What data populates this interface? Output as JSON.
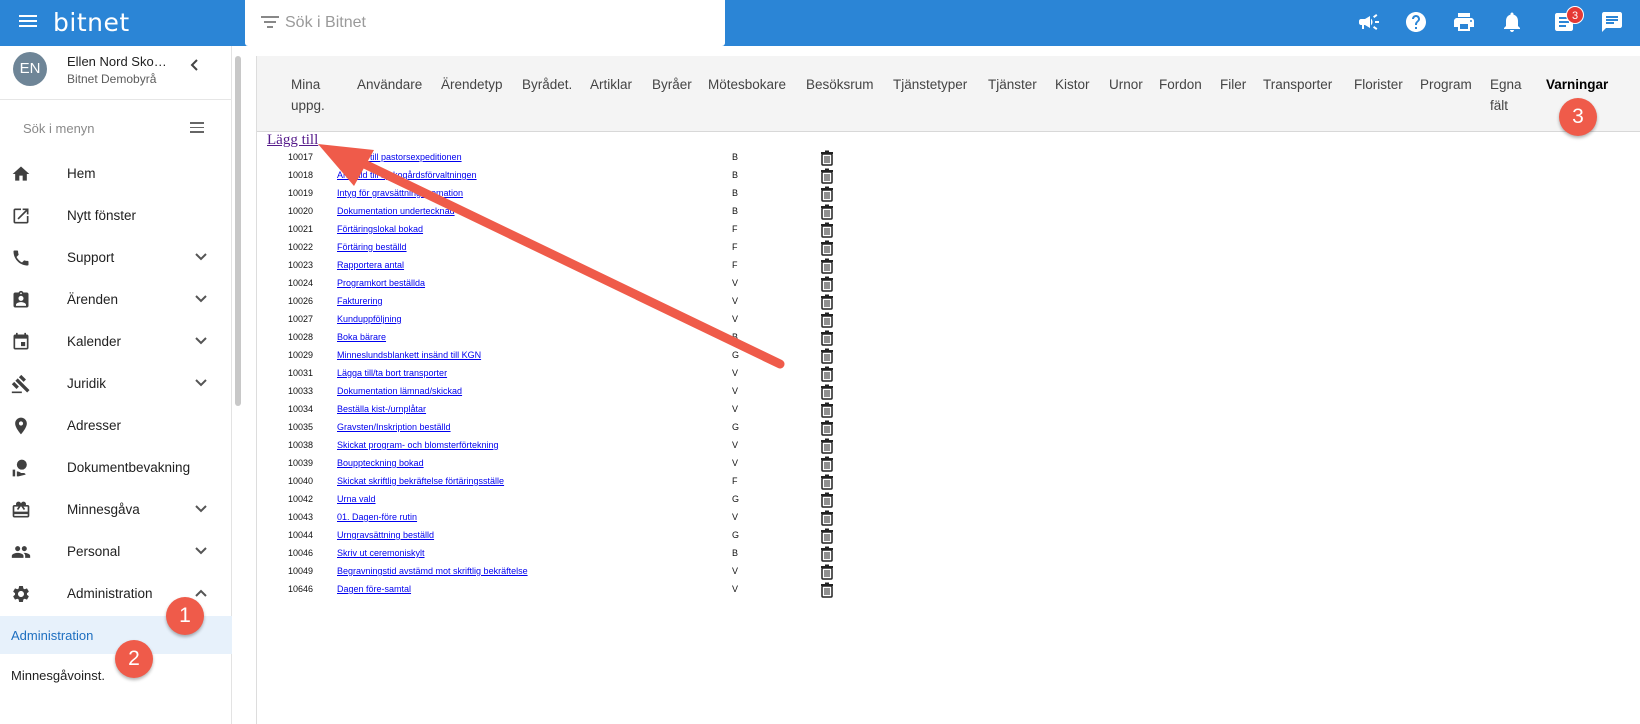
{
  "app": {
    "logo": "bitnet",
    "search_placeholder": "Sök i Bitnet",
    "notification_count": "3"
  },
  "user": {
    "initials": "EN",
    "name": "Ellen Nord Sko…",
    "org": "Bitnet Demobyrå"
  },
  "sidebar": {
    "search_placeholder": "Sök i menyn",
    "items": [
      {
        "label": "Hem",
        "icon": "home-icon"
      },
      {
        "label": "Nytt fönster",
        "icon": "open-in-new-icon"
      },
      {
        "label": "Support",
        "icon": "phone-icon"
      },
      {
        "label": "Ärenden",
        "icon": "assignment-icon"
      },
      {
        "label": "Kalender",
        "icon": "calendar-icon"
      },
      {
        "label": "Juridik",
        "icon": "gavel-icon"
      },
      {
        "label": "Adresser",
        "icon": "location-pin-icon"
      },
      {
        "label": "Dokumentbevakning",
        "icon": "document-watch-icon"
      },
      {
        "label": "Minnesgåva",
        "icon": "gift-card-icon"
      },
      {
        "label": "Personal",
        "icon": "people-icon"
      },
      {
        "label": "Administration",
        "icon": "settings-gear-icon"
      }
    ],
    "sub_items": [
      {
        "label": "Administration"
      },
      {
        "label": "Minnesgåvoinst."
      }
    ]
  },
  "tabs": [
    {
      "label": "Mina uppg."
    },
    {
      "label": "Användare"
    },
    {
      "label": "Ärendetyp"
    },
    {
      "label": "Byrådet."
    },
    {
      "label": "Artiklar"
    },
    {
      "label": "Byråer"
    },
    {
      "label": "Mötesbokare"
    },
    {
      "label": "Besöksrum"
    },
    {
      "label": "Tjänstetyper"
    },
    {
      "label": "Tjänster"
    },
    {
      "label": "Kistor"
    },
    {
      "label": "Urnor"
    },
    {
      "label": "Fordon"
    },
    {
      "label": "Filer"
    },
    {
      "label": "Transporter"
    },
    {
      "label": "Florister"
    },
    {
      "label": "Program"
    },
    {
      "label": "Egna fält"
    },
    {
      "label": "Varningar"
    }
  ],
  "active_tab": "Varningar",
  "add_link": "Lägg till",
  "rows": [
    {
      "id": "10017",
      "name": "Anmäld till pastorsexpeditionen",
      "code": "B"
    },
    {
      "id": "10018",
      "name": "Anmäld till kyrkogårdsförvaltningen",
      "code": "B"
    },
    {
      "id": "10019",
      "name": "Intyg för gravsättning/kremation",
      "code": "B"
    },
    {
      "id": "10020",
      "name": "Dokumentation undertecknad",
      "code": "B"
    },
    {
      "id": "10021",
      "name": "Förtäringslokal bokad",
      "code": "F"
    },
    {
      "id": "10022",
      "name": "Förtäring beställd",
      "code": "F"
    },
    {
      "id": "10023",
      "name": "Rapportera antal",
      "code": "F"
    },
    {
      "id": "10024",
      "name": "Programkort beställda",
      "code": "V"
    },
    {
      "id": "10026",
      "name": "Fakturering",
      "code": "V"
    },
    {
      "id": "10027",
      "name": "Kunduppföljning",
      "code": "V"
    },
    {
      "id": "10028",
      "name": "Boka bärare",
      "code": "B"
    },
    {
      "id": "10029",
      "name": "Minneslundsblankett insänd till KGN",
      "code": "G"
    },
    {
      "id": "10031",
      "name": "Lägga till/ta bort transporter",
      "code": "V"
    },
    {
      "id": "10033",
      "name": "Dokumentation lämnad/skickad",
      "code": "V"
    },
    {
      "id": "10034",
      "name": "Beställa kist-/urnplåtar",
      "code": "V"
    },
    {
      "id": "10035",
      "name": "Gravsten/Inskription beställd",
      "code": "G"
    },
    {
      "id": "10038",
      "name": "Skickat program- och blomsterförtekning",
      "code": "V"
    },
    {
      "id": "10039",
      "name": "Bouppteckning bokad",
      "code": "V"
    },
    {
      "id": "10040",
      "name": "Skickat skriftlig bekräftelse förtäringsställe",
      "code": "F"
    },
    {
      "id": "10042",
      "name": "Urna vald",
      "code": "G"
    },
    {
      "id": "10043",
      "name": "01. Dagen-före rutin",
      "code": "V"
    },
    {
      "id": "10044",
      "name": "Urngravsättning beställd",
      "code": "G"
    },
    {
      "id": "10046",
      "name": "Skriv ut ceremoniskylt",
      "code": "B"
    },
    {
      "id": "10049",
      "name": "Begravningstid avstämd mot skriftlig bekräftelse",
      "code": "V"
    },
    {
      "id": "10646",
      "name": "Dagen före-samtal",
      "code": "V"
    }
  ],
  "markers": [
    "1",
    "2",
    "3"
  ],
  "colors": {
    "topbar": "#2b85d6",
    "marker": "#ef5b4a",
    "link": "#0000ee"
  }
}
